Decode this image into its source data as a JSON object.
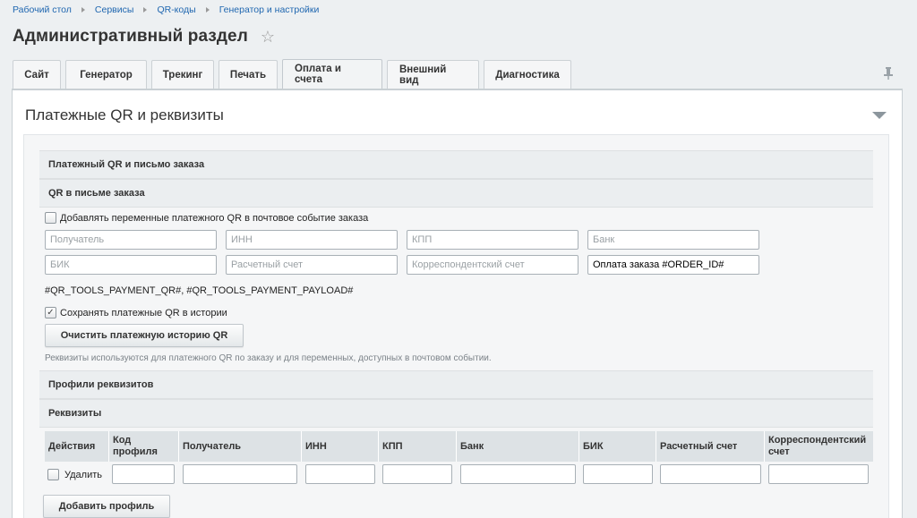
{
  "breadcrumb": [
    "Рабочий стол",
    "Сервисы",
    "QR-коды",
    "Генератор и настройки"
  ],
  "page": {
    "title": "Административный раздел"
  },
  "tabs": [
    {
      "label": "Сайт",
      "active": false
    },
    {
      "label": "Генератор",
      "active": false
    },
    {
      "label": "Трекинг",
      "active": false
    },
    {
      "label": "Печать",
      "active": false
    },
    {
      "label": "Оплата и счета",
      "active": true
    },
    {
      "label": "Внешний вид",
      "active": false
    },
    {
      "label": "Диагностика",
      "active": false
    }
  ],
  "panel": {
    "title": "Платежные QR и реквизиты",
    "section_main": "Платежный QR и письмо заказа",
    "section_email": "QR в письме заказа",
    "add_vars_label": "Добавлять переменные платежного QR в почтовое событие заказа",
    "add_vars_checked": false,
    "fields": {
      "recipient": {
        "placeholder": "Получатель",
        "value": ""
      },
      "inn": {
        "placeholder": "ИНН",
        "value": ""
      },
      "kpp": {
        "placeholder": "КПП",
        "value": ""
      },
      "bank": {
        "placeholder": "Банк",
        "value": ""
      },
      "bik": {
        "placeholder": "БИК",
        "value": ""
      },
      "account": {
        "placeholder": "Расчетный счет",
        "value": ""
      },
      "corr_account": {
        "placeholder": "Корреспондентский счет",
        "value": ""
      },
      "purpose": {
        "placeholder": "",
        "value": "Оплата заказа #ORDER_ID#"
      }
    },
    "macros": "#QR_TOOLS_PAYMENT_QR#, #QR_TOOLS_PAYMENT_PAYLOAD#",
    "save_history_label": "Сохранять платежные QR в истории",
    "save_history_checked": true,
    "clear_history_button": "Очистить платежную историю QR",
    "hint": "Реквизиты используются для платежного QR по заказу и для переменных, доступных в почтовом событии.",
    "section_profiles": "Профили реквизитов",
    "section_requisites": "Реквизиты",
    "table": {
      "columns": [
        "Действия",
        "Код профиля",
        "Получатель",
        "ИНН",
        "КПП",
        "Банк",
        "БИК",
        "Расчетный счет",
        "Корреспондентский счет"
      ],
      "row": {
        "delete_label": "Удалить",
        "delete_checked": false
      }
    },
    "add_profile_button": "Добавить профиль"
  }
}
